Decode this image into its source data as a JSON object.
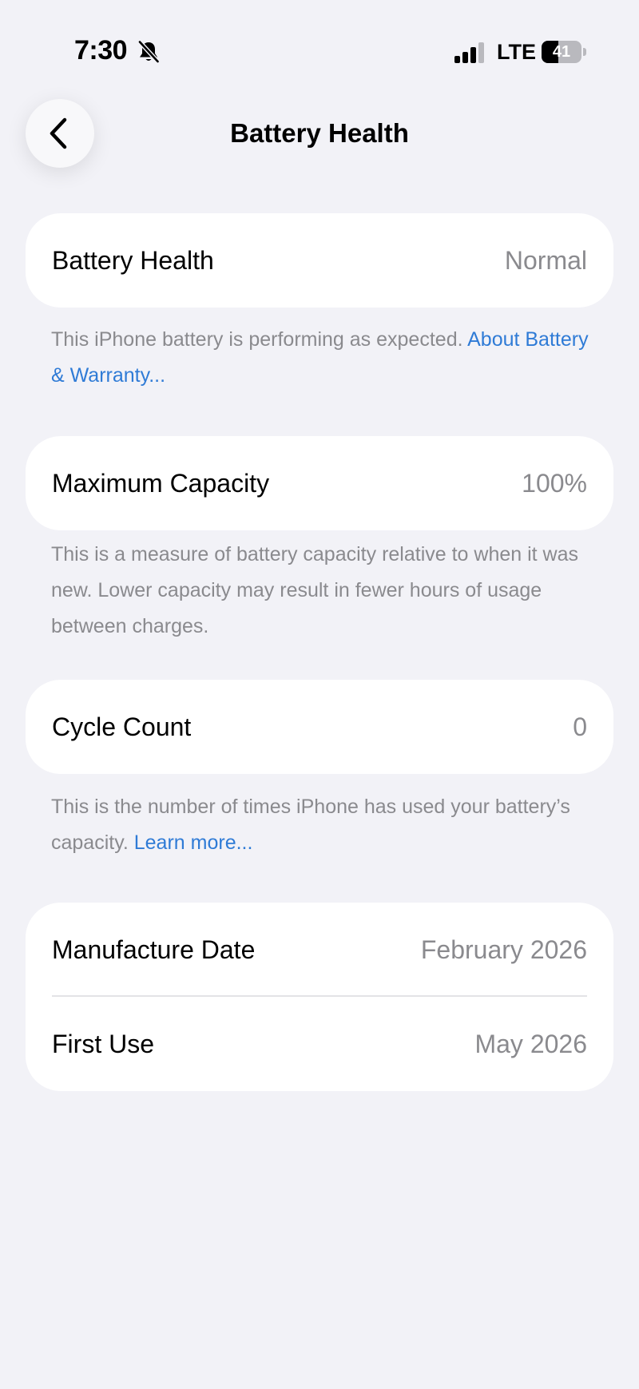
{
  "status_bar": {
    "time": "7:30",
    "silent_icon": "bell-slash-icon",
    "network": "LTE",
    "signal_icon": "cellular-signal-icon",
    "battery_level": "41",
    "battery_fraction": 0.41
  },
  "nav": {
    "back_icon": "chevron-left-icon",
    "title": "Battery Health"
  },
  "sections": {
    "health": {
      "label": "Battery Health",
      "value": "Normal",
      "footnote_text": "This iPhone battery is performing as expected. ",
      "footnote_link": "About Battery & Warranty..."
    },
    "capacity": {
      "label": "Maximum Capacity",
      "value": "100%",
      "footnote_text": "This is a measure of battery capacity relative to when it was new. Lower capacity may result in fewer hours of usage between charges."
    },
    "cycles": {
      "label": "Cycle Count",
      "value": "0",
      "footnote_text": "This is the number of times iPhone has used your battery’s capacity. ",
      "footnote_link": "Learn more..."
    },
    "dates": {
      "manufacture_label": "Manufacture Date",
      "manufacture_value": "February 2026",
      "first_use_label": "First Use",
      "first_use_value": "May 2026"
    }
  },
  "colors": {
    "background": "#F2F2F7",
    "card": "#FFFFFF",
    "secondary_text": "#8A8A8E",
    "link": "#2F7BD6"
  }
}
